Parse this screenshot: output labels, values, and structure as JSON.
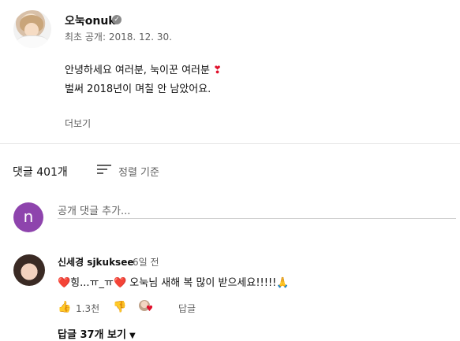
{
  "channel": {
    "name": "오눅onuk",
    "publish_date": "최초 공개: 2018. 12. 30."
  },
  "description": {
    "line1": "안녕하세요 여러분, 눅이꾼 여러분",
    "line1_emoji": "❣",
    "line2": "벌써 2018년이 며칠 안 남았어요.",
    "more_label": "더보기"
  },
  "comments_header": {
    "count_label": "댓글 401개",
    "sort_label": "정렬 기준"
  },
  "add_comment": {
    "avatar_letter": "n",
    "placeholder": "공개 댓글 추가..."
  },
  "comment": {
    "author": "신세경 sjkuksee",
    "time": "6일 전",
    "text": "❤️힝...ㅠ_ㅠ❤️ 오눅님 새해 복 많이 받으세요!!!!!🙏",
    "likes": "1.3천",
    "reply_label": "답글",
    "replies_toggle": "답글 37개 보기"
  },
  "colors": {
    "accent_heart": "#e0102b",
    "user_avatar_bg": "#8e44ad",
    "secondary_text": "#606060"
  }
}
